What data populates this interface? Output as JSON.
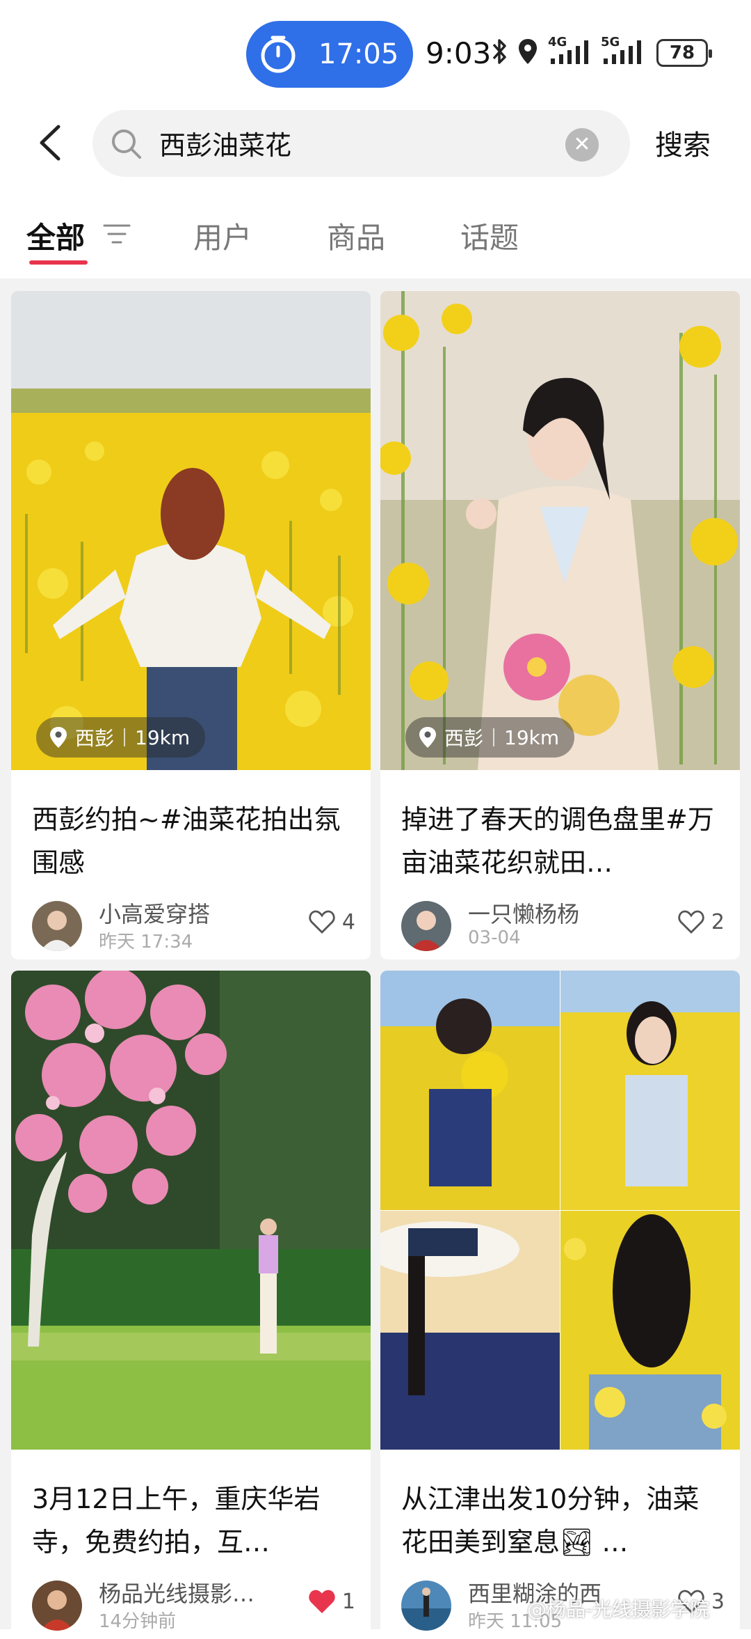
{
  "status_bar": {
    "timer": "17:05",
    "time": "9:03",
    "signal_1_label": "4G",
    "signal_2_label": "5G",
    "battery": "78",
    "icons": [
      "timer-icon",
      "bluetooth-icon",
      "location-icon",
      "signal-4g-icon",
      "signal-5g-icon",
      "battery-icon"
    ]
  },
  "search": {
    "query": "西彭油菜花",
    "button": "搜索"
  },
  "tabs": [
    {
      "label": "全部",
      "active": true
    },
    {
      "label": "用户",
      "active": false
    },
    {
      "label": "商品",
      "active": false
    },
    {
      "label": "话题",
      "active": false
    }
  ],
  "posts": [
    {
      "title": "西彭约拍~#油菜花拍出氛围感",
      "location": "西彭",
      "distance": "19km",
      "author": "小高爱穿搭",
      "time": "昨天 17:34",
      "likes": "4",
      "liked": false
    },
    {
      "title": "掉进了春天的调色盘里#万亩油菜花织就田…",
      "location": "西彭",
      "distance": "19km",
      "author": "一只懒杨杨",
      "time": "03-04",
      "likes": "2",
      "liked": false
    },
    {
      "title": "3月12日上午，重庆华岩寺，免费约拍，互…",
      "author": "杨品光线摄影…",
      "time": "14分钟前",
      "likes": "1",
      "liked": true
    },
    {
      "title": "从江津出发10分钟，油菜花田美到窒息🏞 …",
      "author": "西里糊涂的西",
      "time": "昨天 11:05",
      "likes": "3",
      "liked": false
    }
  ],
  "watermark": "@杨品-光线摄影学院",
  "colors": {
    "accent": "#e8354d",
    "timer_pill": "#2f6fe8",
    "rapeseed_yellow": "#f2d21a",
    "like_red": "#e8354d"
  }
}
